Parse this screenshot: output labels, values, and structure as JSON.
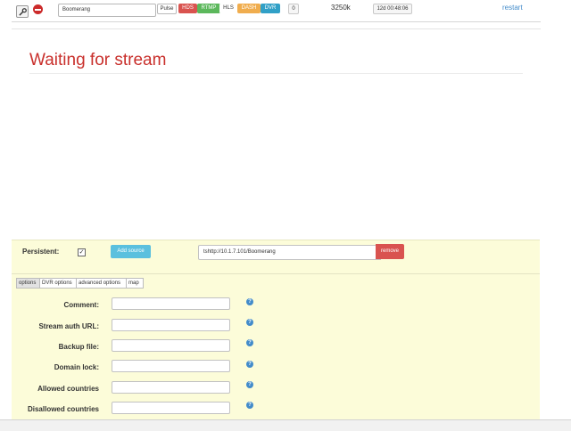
{
  "stream_row": {
    "name_value": "Boomerang",
    "tags": {
      "pulse": "Pulse",
      "hds": "HDS",
      "rtmp": "RTMP",
      "hls": "HLS",
      "dash": "DASH",
      "dvr": "DVR"
    },
    "clients_count": "0",
    "bitrate": "3250k",
    "uptime": "12d 00:48:06",
    "restart_label": "restart"
  },
  "status": {
    "message": "Waiting for stream"
  },
  "source": {
    "persistent_label": "Persistent:",
    "persistent_check": "✓",
    "add_source_label": "Add source",
    "url_value": "tshttp://10.1.7.101/Boomerang",
    "remove_label": "remove"
  },
  "tabs": {
    "options": "options",
    "dvr": "DVR options",
    "advanced": "advanced options",
    "map": "map"
  },
  "fields": {
    "comment": {
      "label": "Comment:",
      "value": ""
    },
    "auth_url": {
      "label": "Stream auth URL:",
      "value": ""
    },
    "backup": {
      "label": "Backup file:",
      "value": ""
    },
    "domain_lock": {
      "label": "Domain lock:",
      "value": ""
    },
    "allowed_countries": {
      "label": "Allowed countries",
      "value": ""
    },
    "disallowed_countries": {
      "label": "Disallowed countries",
      "value": ""
    },
    "help_glyph": "?"
  },
  "colors": {
    "accent_blue": "#428bca",
    "danger": "#d9534f",
    "success": "#5cb85c",
    "warning": "#f0ad4e",
    "info": "#5bc0de",
    "panel_bg": "#fcfcd9"
  }
}
